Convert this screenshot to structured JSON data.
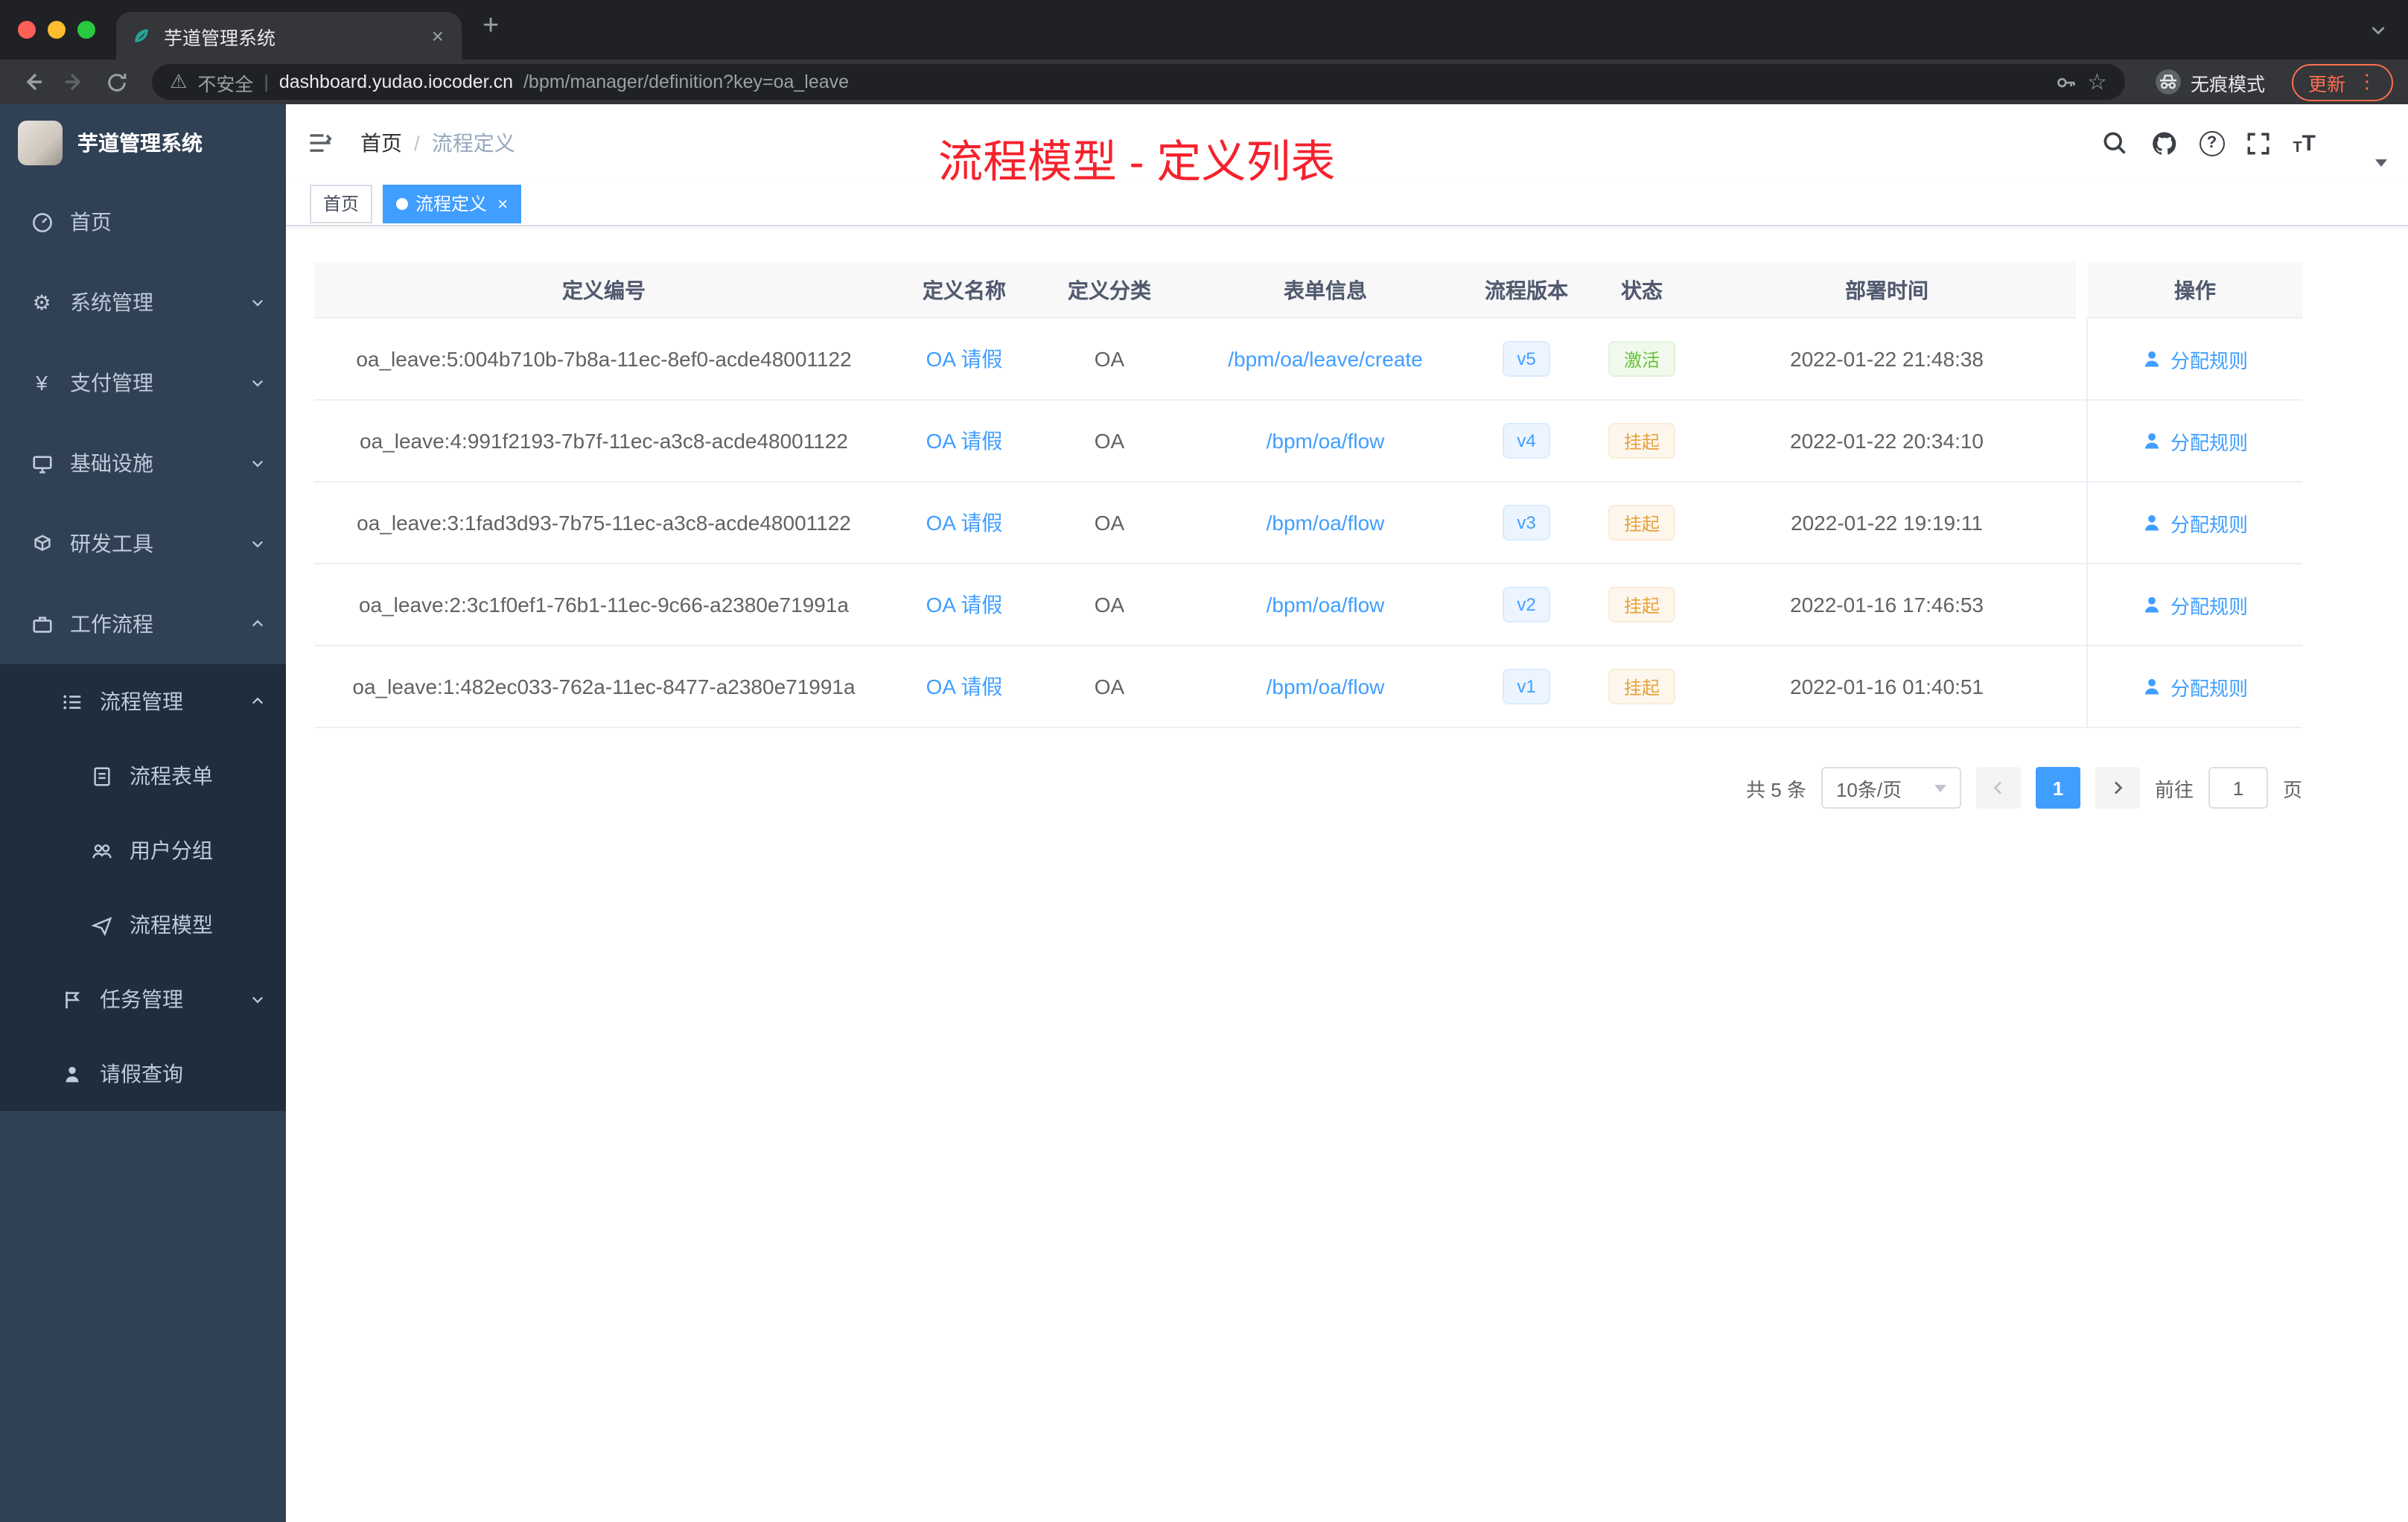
{
  "colors": {
    "accent": "#409eff",
    "sidebar_bg": "#304156",
    "submenu_bg": "#1f2d3d",
    "overlay_title_red": "#f5222d",
    "status_active_green": "#67c23a",
    "status_suspend_orange": "#e6a23c",
    "update_pill_orange": "#ff6e4f"
  },
  "icons": {
    "close": "×",
    "new_tab": "+",
    "warning": "⚠",
    "star": "☆",
    "kebab": "⋮",
    "gear": "⚙",
    "yen": "¥",
    "question": "?",
    "divider": "|"
  },
  "browser": {
    "tab_title": "芋道管理系统",
    "security_label": "不安全",
    "url_host": "dashboard.yudao.iocoder.cn",
    "url_path": "/bpm/manager/definition?key=oa_leave",
    "incognito_label": "无痕模式",
    "update_label": "更新"
  },
  "sidebar": {
    "logo_title": "芋道管理系统",
    "items": [
      {
        "label": "首页",
        "icon": "dashboard-icon"
      },
      {
        "label": "系统管理",
        "icon": "gear-icon"
      },
      {
        "label": "支付管理",
        "icon": "yen-icon"
      },
      {
        "label": "基础设施",
        "icon": "infrastructure-icon"
      },
      {
        "label": "研发工具",
        "icon": "tools-icon"
      },
      {
        "label": "工作流程",
        "icon": "workflow-icon"
      },
      {
        "label": "流程管理",
        "icon": "process-management-icon"
      },
      {
        "label": "流程表单",
        "icon": "form-icon"
      },
      {
        "label": "用户分组",
        "icon": "user-group-icon"
      },
      {
        "label": "流程模型",
        "icon": "model-icon"
      },
      {
        "label": "任务管理",
        "icon": "task-icon"
      },
      {
        "label": "请假查询",
        "icon": "leave-query-icon"
      }
    ]
  },
  "navbar": {
    "breadcrumb_home": "首页",
    "breadcrumb_sep": "/",
    "breadcrumb_current": "流程定义",
    "overlay_title": "流程模型 - 定义列表"
  },
  "tags": {
    "home": "首页",
    "active": "流程定义"
  },
  "table": {
    "columns": [
      "定义编号",
      "定义名称",
      "定义分类",
      "表单信息",
      "流程版本",
      "状态",
      "部署时间",
      "操作"
    ],
    "rows": [
      {
        "id": "oa_leave:5:004b710b-7b8a-11ec-8ef0-acde48001122",
        "name": "OA 请假",
        "category": "OA",
        "form": "/bpm/oa/leave/create",
        "version": "v5",
        "status": "激活",
        "status_type": "success",
        "time": "2022-01-22 21:48:38",
        "action": "分配规则"
      },
      {
        "id": "oa_leave:4:991f2193-7b7f-11ec-a3c8-acde48001122",
        "name": "OA 请假",
        "category": "OA",
        "form": "/bpm/oa/flow",
        "version": "v4",
        "status": "挂起",
        "status_type": "warning",
        "time": "2022-01-22 20:34:10",
        "action": "分配规则"
      },
      {
        "id": "oa_leave:3:1fad3d93-7b75-11ec-a3c8-acde48001122",
        "name": "OA 请假",
        "category": "OA",
        "form": "/bpm/oa/flow",
        "version": "v3",
        "status": "挂起",
        "status_type": "warning",
        "time": "2022-01-22 19:19:11",
        "action": "分配规则"
      },
      {
        "id": "oa_leave:2:3c1f0ef1-76b1-11ec-9c66-a2380e71991a",
        "name": "OA 请假",
        "category": "OA",
        "form": "/bpm/oa/flow",
        "version": "v2",
        "status": "挂起",
        "status_type": "warning",
        "time": "2022-01-16 17:46:53",
        "action": "分配规则"
      },
      {
        "id": "oa_leave:1:482ec033-762a-11ec-8477-a2380e71991a",
        "name": "OA 请假",
        "category": "OA",
        "form": "/bpm/oa/flow",
        "version": "v1",
        "status": "挂起",
        "status_type": "warning",
        "time": "2022-01-16 01:40:51",
        "action": "分配规则"
      }
    ]
  },
  "pagination": {
    "total": "共 5 条",
    "page_size": "10条/页",
    "page": "1",
    "goto_label": "前往",
    "goto_value": "1",
    "unit_label": "页"
  }
}
